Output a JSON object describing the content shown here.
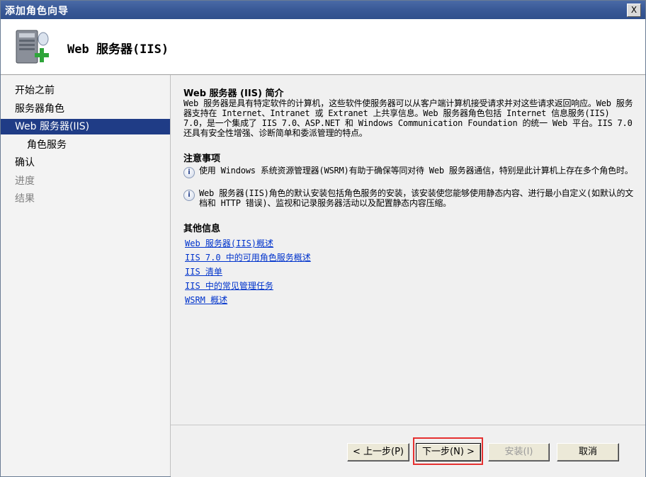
{
  "window": {
    "title": "添加角色向导",
    "close_label": "X"
  },
  "header": {
    "title": "Web 服务器(IIS)",
    "icon": "server-add-icon"
  },
  "sidebar": {
    "items": [
      {
        "label": "开始之前",
        "state": "normal"
      },
      {
        "label": "服务器角色",
        "state": "normal"
      },
      {
        "label": "Web 服务器(IIS)",
        "state": "active"
      },
      {
        "label": "角色服务",
        "state": "sub"
      },
      {
        "label": "确认",
        "state": "normal"
      },
      {
        "label": "进度",
        "state": "disabled"
      },
      {
        "label": "结果",
        "state": "disabled"
      }
    ]
  },
  "content": {
    "intro_title": "Web 服务器 (IIS) 简介",
    "intro_text": "Web 服务器是具有特定软件的计算机，这些软件使服务器可以从客户端计算机接受请求并对这些请求返回响应。Web 服务器支持在 Internet、Intranet 或 Extranet 上共享信息。Web 服务器角色包括 Internet 信息服务(IIS) 7.0，是一个集成了 IIS 7.0、ASP.NET 和 Windows Communication Foundation 的统一 Web 平台。IIS 7.0 还具有安全性增强、诊断简单和委派管理的特点。",
    "notes_title": "注意事项",
    "notes": [
      "使用 Windows 系统资源管理器(WSRM)有助于确保等同对待 Web 服务器通信，特别是此计算机上存在多个角色时。",
      "Web 服务器(IIS)角色的默认安装包括角色服务的安装，该安装使您能够使用静态内容、进行最小自定义(如默认的文档和 HTTP 错误)、监视和记录服务器活动以及配置静态内容压缩。"
    ],
    "more_title": "其他信息",
    "links": [
      "Web 服务器(IIS)概述",
      "IIS 7.0 中的可用角色服务概述",
      "IIS 清单",
      "IIS 中的常见管理任务",
      "WSRM 概述"
    ]
  },
  "footer": {
    "back_label": "< 上一步(P)",
    "next_label": "下一步(N) >",
    "install_label": "安装(I)",
    "cancel_label": "取消"
  },
  "colors": {
    "accent": "#1f3c86",
    "highlight": "#e53030",
    "link": "#0033cc"
  }
}
